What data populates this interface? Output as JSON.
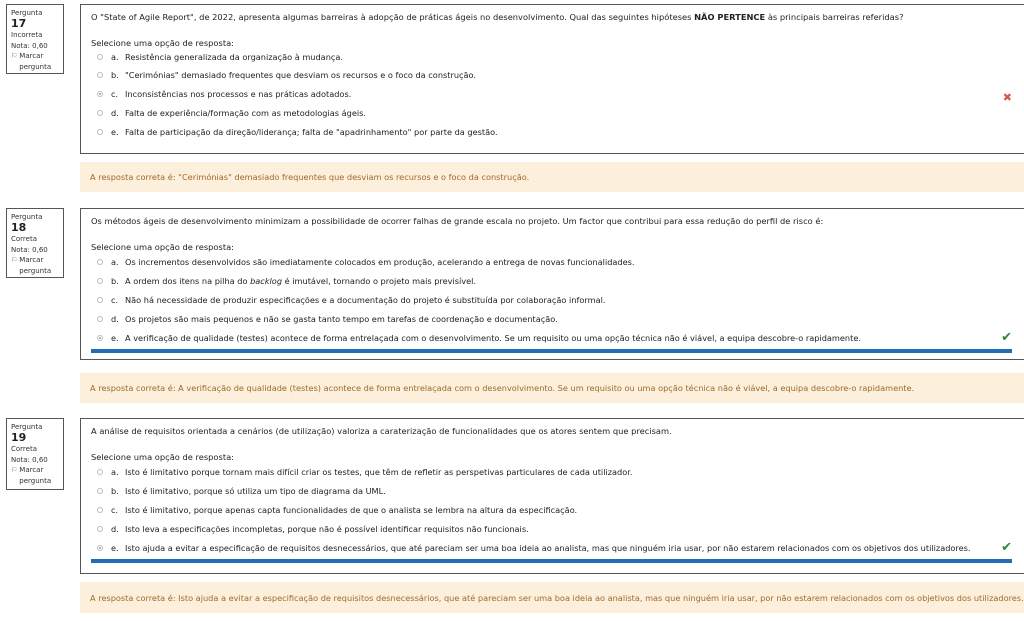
{
  "questions": [
    {
      "label": "Pergunta",
      "number": "17",
      "status": "Incorreta",
      "grade": "Nota: 0,60",
      "flag": "Marcar pergunta",
      "text": "O \"State of Agile Report\", de 2022, apresenta algumas barreiras à adopção de práticas ágeis no desenvolvimento. Qual das seguintes hipóteses ",
      "text_bold": "NÃO PERTENCE",
      "text_tail": " às principais barreiras referidas?",
      "prompt": "Selecione uma opção de resposta:",
      "options": [
        {
          "letter": "a.",
          "text": "Resistência generalizada da organização à mudança."
        },
        {
          "letter": "b.",
          "text": "\"Cerimónias\" demasiado frequentes que desviam os recursos e o foco da construção."
        },
        {
          "letter": "c.",
          "text": "Inconsistências nos processos e nas práticas adotados."
        },
        {
          "letter": "d.",
          "text": "Falta de experiência/formação com as metodologias ágeis."
        },
        {
          "letter": "e.",
          "text": "Falta de participação da direção/liderança; falta de \"apadrinhamento\" por parte da gestão."
        }
      ],
      "mark": "✖",
      "feedback": "A resposta correta é: \"Cerimónias\" demasiado frequentes que desviam os recursos e o foco da construção."
    },
    {
      "label": "Pergunta",
      "number": "18",
      "status": "Correta",
      "grade": "Nota: 0,60",
      "flag": "Marcar pergunta",
      "text": "Os métodos ágeis de desenvolvimento minimizam a possibilidade de ocorrer falhas de grande escala no projeto. Um factor que contribui para essa redução do perfil de risco é:",
      "prompt": "Selecione uma opção de resposta:",
      "options": [
        {
          "letter": "a.",
          "text": "Os incrementos desenvolvidos são imediatamente colocados em produção, acelerando a entrega de novas funcionalidades."
        },
        {
          "letter": "b.",
          "text_pre": "A ordem dos itens na pilha do ",
          "text_italic": "backlog",
          "text_post": " é imutável, tornando o projeto mais previsível."
        },
        {
          "letter": "c.",
          "text": "Não há necessidade de produzir especificações e a documentação do projeto é substituída por colaboração informal."
        },
        {
          "letter": "d.",
          "text": "Os projetos são mais pequenos e não se gasta tanto tempo em tarefas de coordenação e documentação."
        },
        {
          "letter": "e.",
          "text": "A verificação de qualidade (testes) acontece de forma entrelaçada com o desenvolvimento. Se um requisito ou uma opção técnica não é viável, a equipa descobre-o rapidamente."
        }
      ],
      "mark": "✔",
      "feedback": "A resposta correta é: A verificação de qualidade (testes) acontece de forma entrelaçada com o desenvolvimento. Se um requisito ou uma opção técnica não é viável, a equipa descobre-o rapidamente."
    },
    {
      "label": "Pergunta",
      "number": "19",
      "status": "Correta",
      "grade": "Nota: 0,60",
      "flag": "Marcar pergunta",
      "text": "A análise de requisitos orientada a cenários (de utilização) valoriza a caraterização de funcionalidades que os atores sentem que precisam.",
      "prompt": "Selecione uma opção de resposta:",
      "options": [
        {
          "letter": "a.",
          "text": "Isto é limitativo porque tornam mais difícil criar os testes, que têm de refletir as perspetivas particulares de cada utilizador."
        },
        {
          "letter": "b.",
          "text": "Isto é limitativo, porque só utiliza um tipo de diagrama da UML."
        },
        {
          "letter": "c.",
          "text": "Isto é limitativo, porque apenas capta funcionalidades de que o analista se lembra na altura da especificação."
        },
        {
          "letter": "d.",
          "text": "Isto leva a especificações incompletas, porque não é possível identificar requisitos não funcionais."
        },
        {
          "letter": "e.",
          "text": "Isto ajuda a evitar a especificação de requisitos desnecessários, que até pareciam ser uma boa ideia ao analista, mas que ninguém iria usar, por não estarem relacionados com os objetivos dos utilizadores."
        }
      ],
      "mark": "✔",
      "feedback": "A resposta correta é: Isto ajuda a evitar a especificação de requisitos desnecessários, que até pareciam ser uma boa ideia ao analista, mas que ninguém iria usar, por não estarem relacionados com os objetivos dos utilizadores."
    }
  ],
  "colors": {
    "incorrect_mark": "#d9534f",
    "correct_mark": "#2e8540",
    "selected_bar": "#1f6fb2",
    "feedback_bg": "#fcefdc",
    "feedback_text": "#a06a2c"
  }
}
